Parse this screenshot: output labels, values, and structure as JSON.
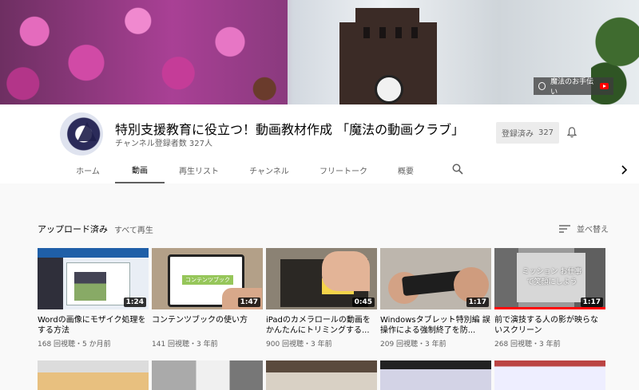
{
  "banner": {
    "link_label": "魔法のお手伝い"
  },
  "channel": {
    "title": "特別支援教育に役立つ！動画教材作成 「魔法の動画クラブ」",
    "subscribers": "チャンネル登録者数 327人",
    "subscribed_label": "登録済み",
    "subscribed_count": "327"
  },
  "tabs": [
    {
      "label": "ホーム",
      "active": false
    },
    {
      "label": "動画",
      "active": true
    },
    {
      "label": "再生リスト",
      "active": false
    },
    {
      "label": "チャンネル",
      "active": false
    },
    {
      "label": "フリートーク",
      "active": false
    },
    {
      "label": "概要",
      "active": false
    }
  ],
  "section": {
    "title": "アップロード済み",
    "play_all": "すべて再生",
    "sort_label": "並べ替え"
  },
  "videos": [
    {
      "title": "Wordの画像にモザイク処理をする方法",
      "duration": "1:24",
      "meta": "168 回視聴・5 か月前"
    },
    {
      "title": "コンテンツブックの使い方",
      "duration": "1:47",
      "meta": "141 回視聴・3 年前",
      "thumb_text": "コンテンツブック"
    },
    {
      "title": "iPadのカメラロールの動画をかんたんにトリミングする...",
      "duration": "0:45",
      "meta": "900 回視聴・3 年前"
    },
    {
      "title": "Windowsタブレット特別編 誤操作による強制終了を防...",
      "duration": "1:17",
      "meta": "209 回視聴・3 年前"
    },
    {
      "title": "前で演技する人の影が映らないスクリーン",
      "duration": "1:17",
      "meta": "268 回視聴・3 年前",
      "thumb_text": "ミッション お仕事で笑顔にしよう"
    }
  ],
  "colors": {
    "accent_red": "#ff0000",
    "text_primary": "#030303",
    "text_secondary": "#606060"
  }
}
